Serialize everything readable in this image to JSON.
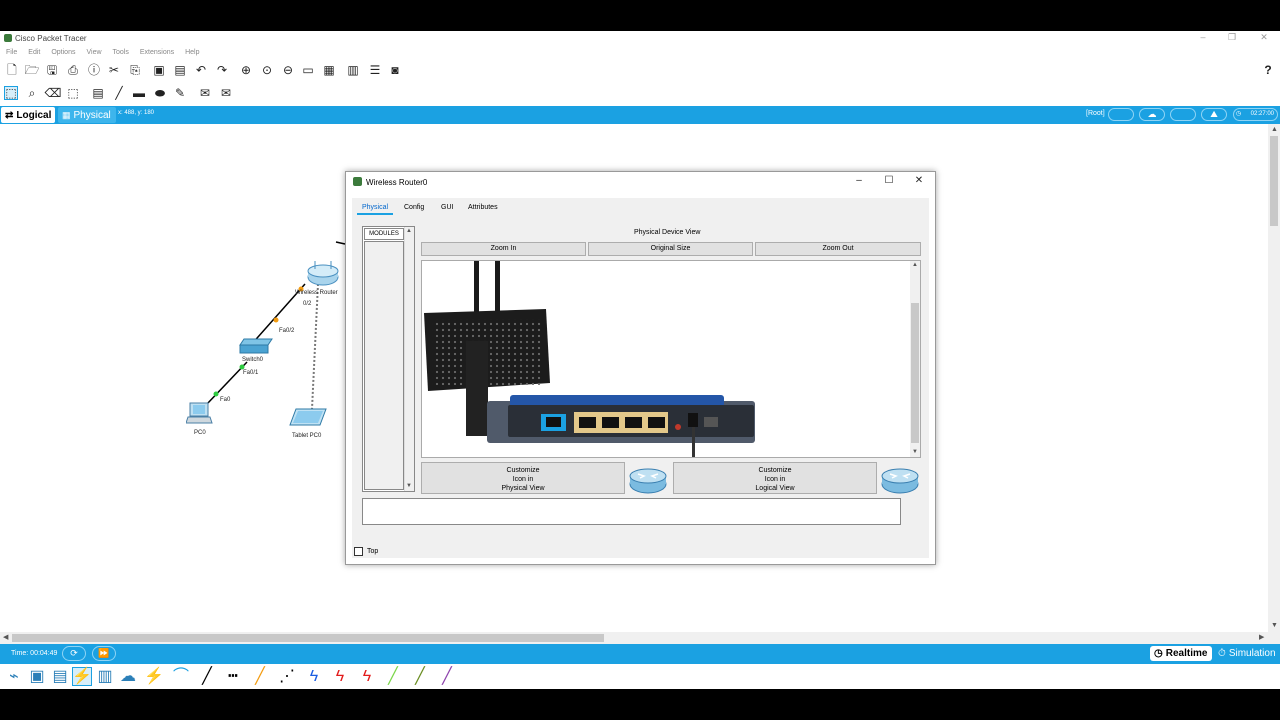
{
  "window": {
    "title": "Cisco Packet Tracer"
  },
  "menu": [
    "File",
    "Edit",
    "Options",
    "View",
    "Tools",
    "Extensions",
    "Help"
  ],
  "toolbar_main": {
    "icons": [
      "new-icon",
      "open-icon",
      "save-icon",
      "print-icon",
      "activity-wizard-icon",
      "scissors-icon",
      "copy-icon",
      "paste-icon",
      "undo-icon",
      "redo-icon",
      "zoom-in-icon",
      "zoom-reset-icon",
      "zoom-out-icon",
      "palette-icon",
      "custom-device-icon",
      "notes-icon",
      "cluster-icon",
      "screenshot-icon"
    ],
    "help_label": "?"
  },
  "toolbar_tools": {
    "icons": [
      "select-icon",
      "inspect-icon",
      "delete-icon",
      "resize-icon",
      "note-icon",
      "line-icon",
      "rectangle-icon",
      "ellipse-icon",
      "freeform-icon",
      "add-simple-pdu-icon",
      "add-complex-pdu-icon"
    ]
  },
  "viewbar": {
    "logical_label": "Logical",
    "physical_label": "Physical",
    "coords": "x: 488, y: 180",
    "root_label": "[Root]",
    "clock": "02:27:00"
  },
  "topology": {
    "router_label": "Wireless Router",
    "router_port": "0/2",
    "switch_label": "Switch0",
    "switch_port_up": "Fa0/2",
    "switch_port_down": "Fa0/1",
    "pc_label": "PC0",
    "pc_port": "Fa0",
    "tablet_label": "Tablet PC0"
  },
  "dialog": {
    "title": "Wireless Router0",
    "tabs": [
      "Physical",
      "Config",
      "GUI",
      "Attributes"
    ],
    "active_tab": "Physical",
    "modules_label": "MODULES",
    "pdv_label": "Physical Device View",
    "zoom_in": "Zoom In",
    "original_size": "Original Size",
    "zoom_out": "Zoom Out",
    "customize_physical": "Customize\nIcon in\nPhysical View",
    "customize_logical": "Customize\nIcon in\nLogical View",
    "top_label": "Top"
  },
  "bottombar": {
    "time": "Time: 00:04:49",
    "realtime_label": "Realtime",
    "simulation_label": "Simulation"
  },
  "colors": {
    "accent": "#1ba1e2",
    "router_green": "#3b7a3b",
    "link_orange": "#f39c12",
    "link_green": "#2ecc40"
  }
}
